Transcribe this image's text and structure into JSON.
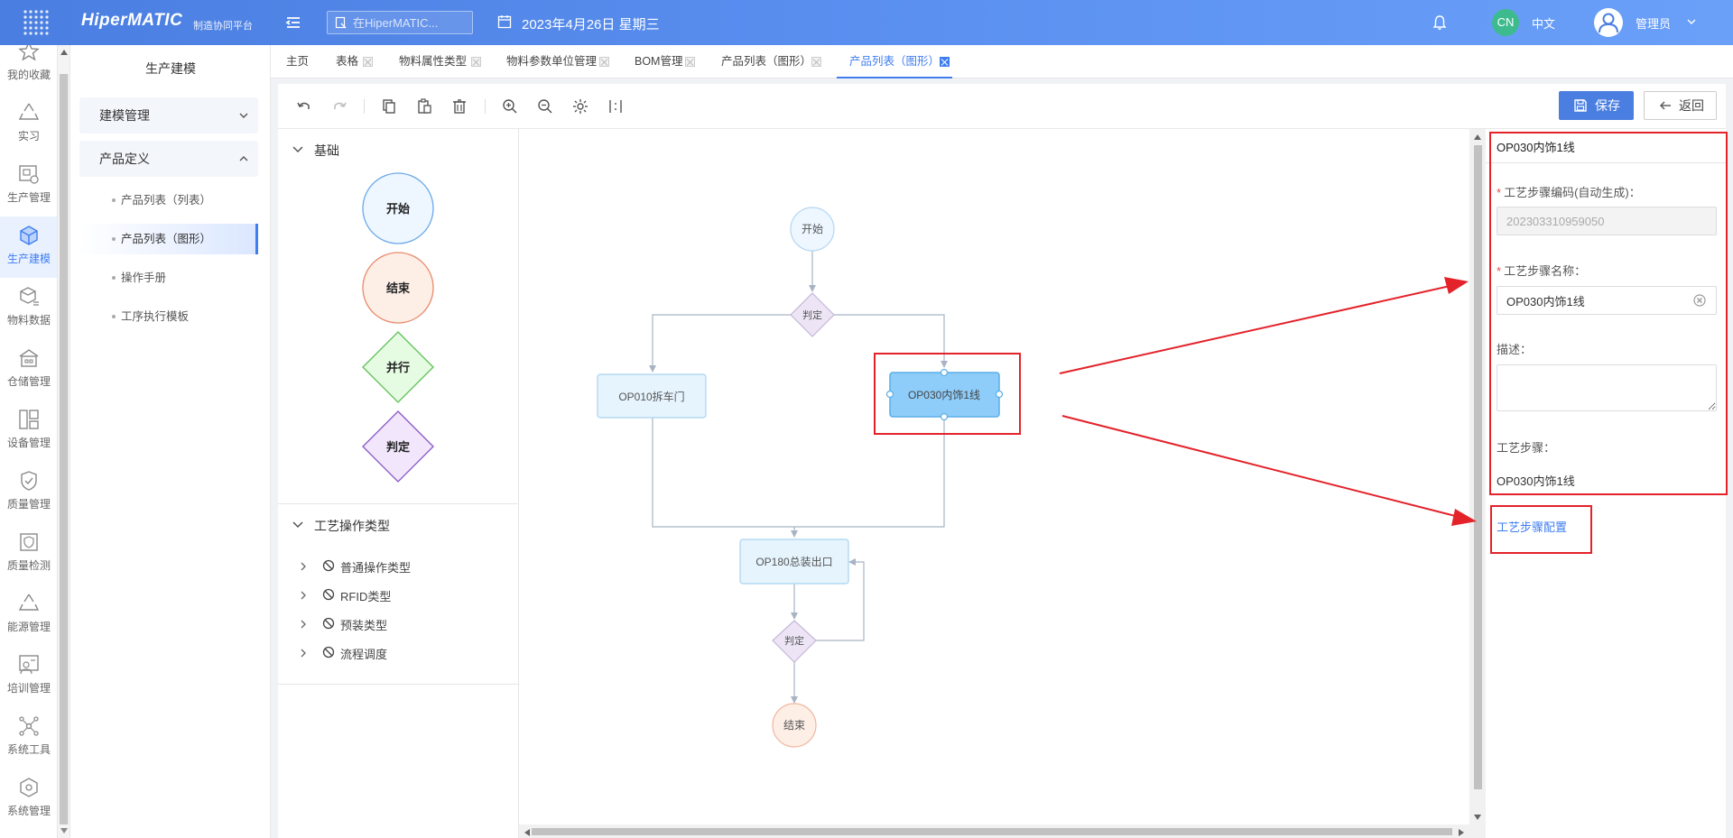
{
  "app": {
    "brand": "HiperMATIC",
    "brand_sub": "制造协同平台",
    "search_placeholder": "在HiperMATIC...",
    "date": "2023年4月26日 星期三",
    "lang_badge": "CN",
    "lang_label": "中文",
    "user_name": "管理员"
  },
  "rail": {
    "items": [
      {
        "label": "我的收藏",
        "icon": "star-icon"
      },
      {
        "label": "实习",
        "icon": "recycle-icon"
      },
      {
        "label": "生产管理",
        "icon": "production-icon"
      },
      {
        "label": "生产建模",
        "icon": "cube-icon"
      },
      {
        "label": "物料数据",
        "icon": "box-icon"
      },
      {
        "label": "仓储管理",
        "icon": "warehouse-icon"
      },
      {
        "label": "设备管理",
        "icon": "device-icon"
      },
      {
        "label": "质量管理",
        "icon": "shield-icon"
      },
      {
        "label": "质量检测",
        "icon": "shield-check-icon"
      },
      {
        "label": "能源管理",
        "icon": "recycle-icon"
      },
      {
        "label": "培训管理",
        "icon": "training-icon"
      },
      {
        "label": "系统工具",
        "icon": "network-icon"
      },
      {
        "label": "系统管理",
        "icon": "settings-cube-icon"
      }
    ]
  },
  "sidebar": {
    "title": "生产建模",
    "groups": [
      {
        "label": "建模管理"
      },
      {
        "label": "产品定义"
      }
    ],
    "subs": [
      {
        "label": "产品列表（列表）"
      },
      {
        "label": "产品列表（图形）"
      },
      {
        "label": "操作手册"
      },
      {
        "label": "工序执行模板"
      }
    ]
  },
  "tabs": [
    {
      "label": "主页"
    },
    {
      "label": "表格"
    },
    {
      "label": "物料属性类型"
    },
    {
      "label": "物料参数单位管理"
    },
    {
      "label": "BOM管理"
    },
    {
      "label": "产品列表（图形）"
    },
    {
      "label": "产品列表（图形）..."
    }
  ],
  "toolbar": {
    "save_label": "保存",
    "back_label": "返回"
  },
  "palette": {
    "basic_title": "基础",
    "shapes": [
      {
        "label": "开始"
      },
      {
        "label": "结束"
      },
      {
        "label": "并行"
      },
      {
        "label": "判定"
      }
    ],
    "ops_title": "工艺操作类型",
    "ops": [
      {
        "label": "普通操作类型"
      },
      {
        "label": "RFID类型"
      },
      {
        "label": "预装类型"
      },
      {
        "label": "流程调度"
      }
    ]
  },
  "flow": {
    "start": "开始",
    "decision1": "判定",
    "op010": "OP010拆车门",
    "op030": "OP030内饰1线",
    "op180": "OP180总装出口",
    "decision2": "判定",
    "end": "结束"
  },
  "props": {
    "header": "OP030内饰1线",
    "code_label": "工艺步骤编码(自动生成)：",
    "code_value": "202303310959050",
    "name_label": "工艺步骤名称：",
    "name_value": "OP030内饰1线",
    "desc_label": "描述：",
    "step_label": "工艺步骤：",
    "step_value": "OP030内饰1线",
    "config_link": "工艺步骤配置"
  },
  "colors": {
    "accent": "#3f7df0",
    "topbar": "#4a7ee0",
    "annotation": "#e3222a"
  }
}
